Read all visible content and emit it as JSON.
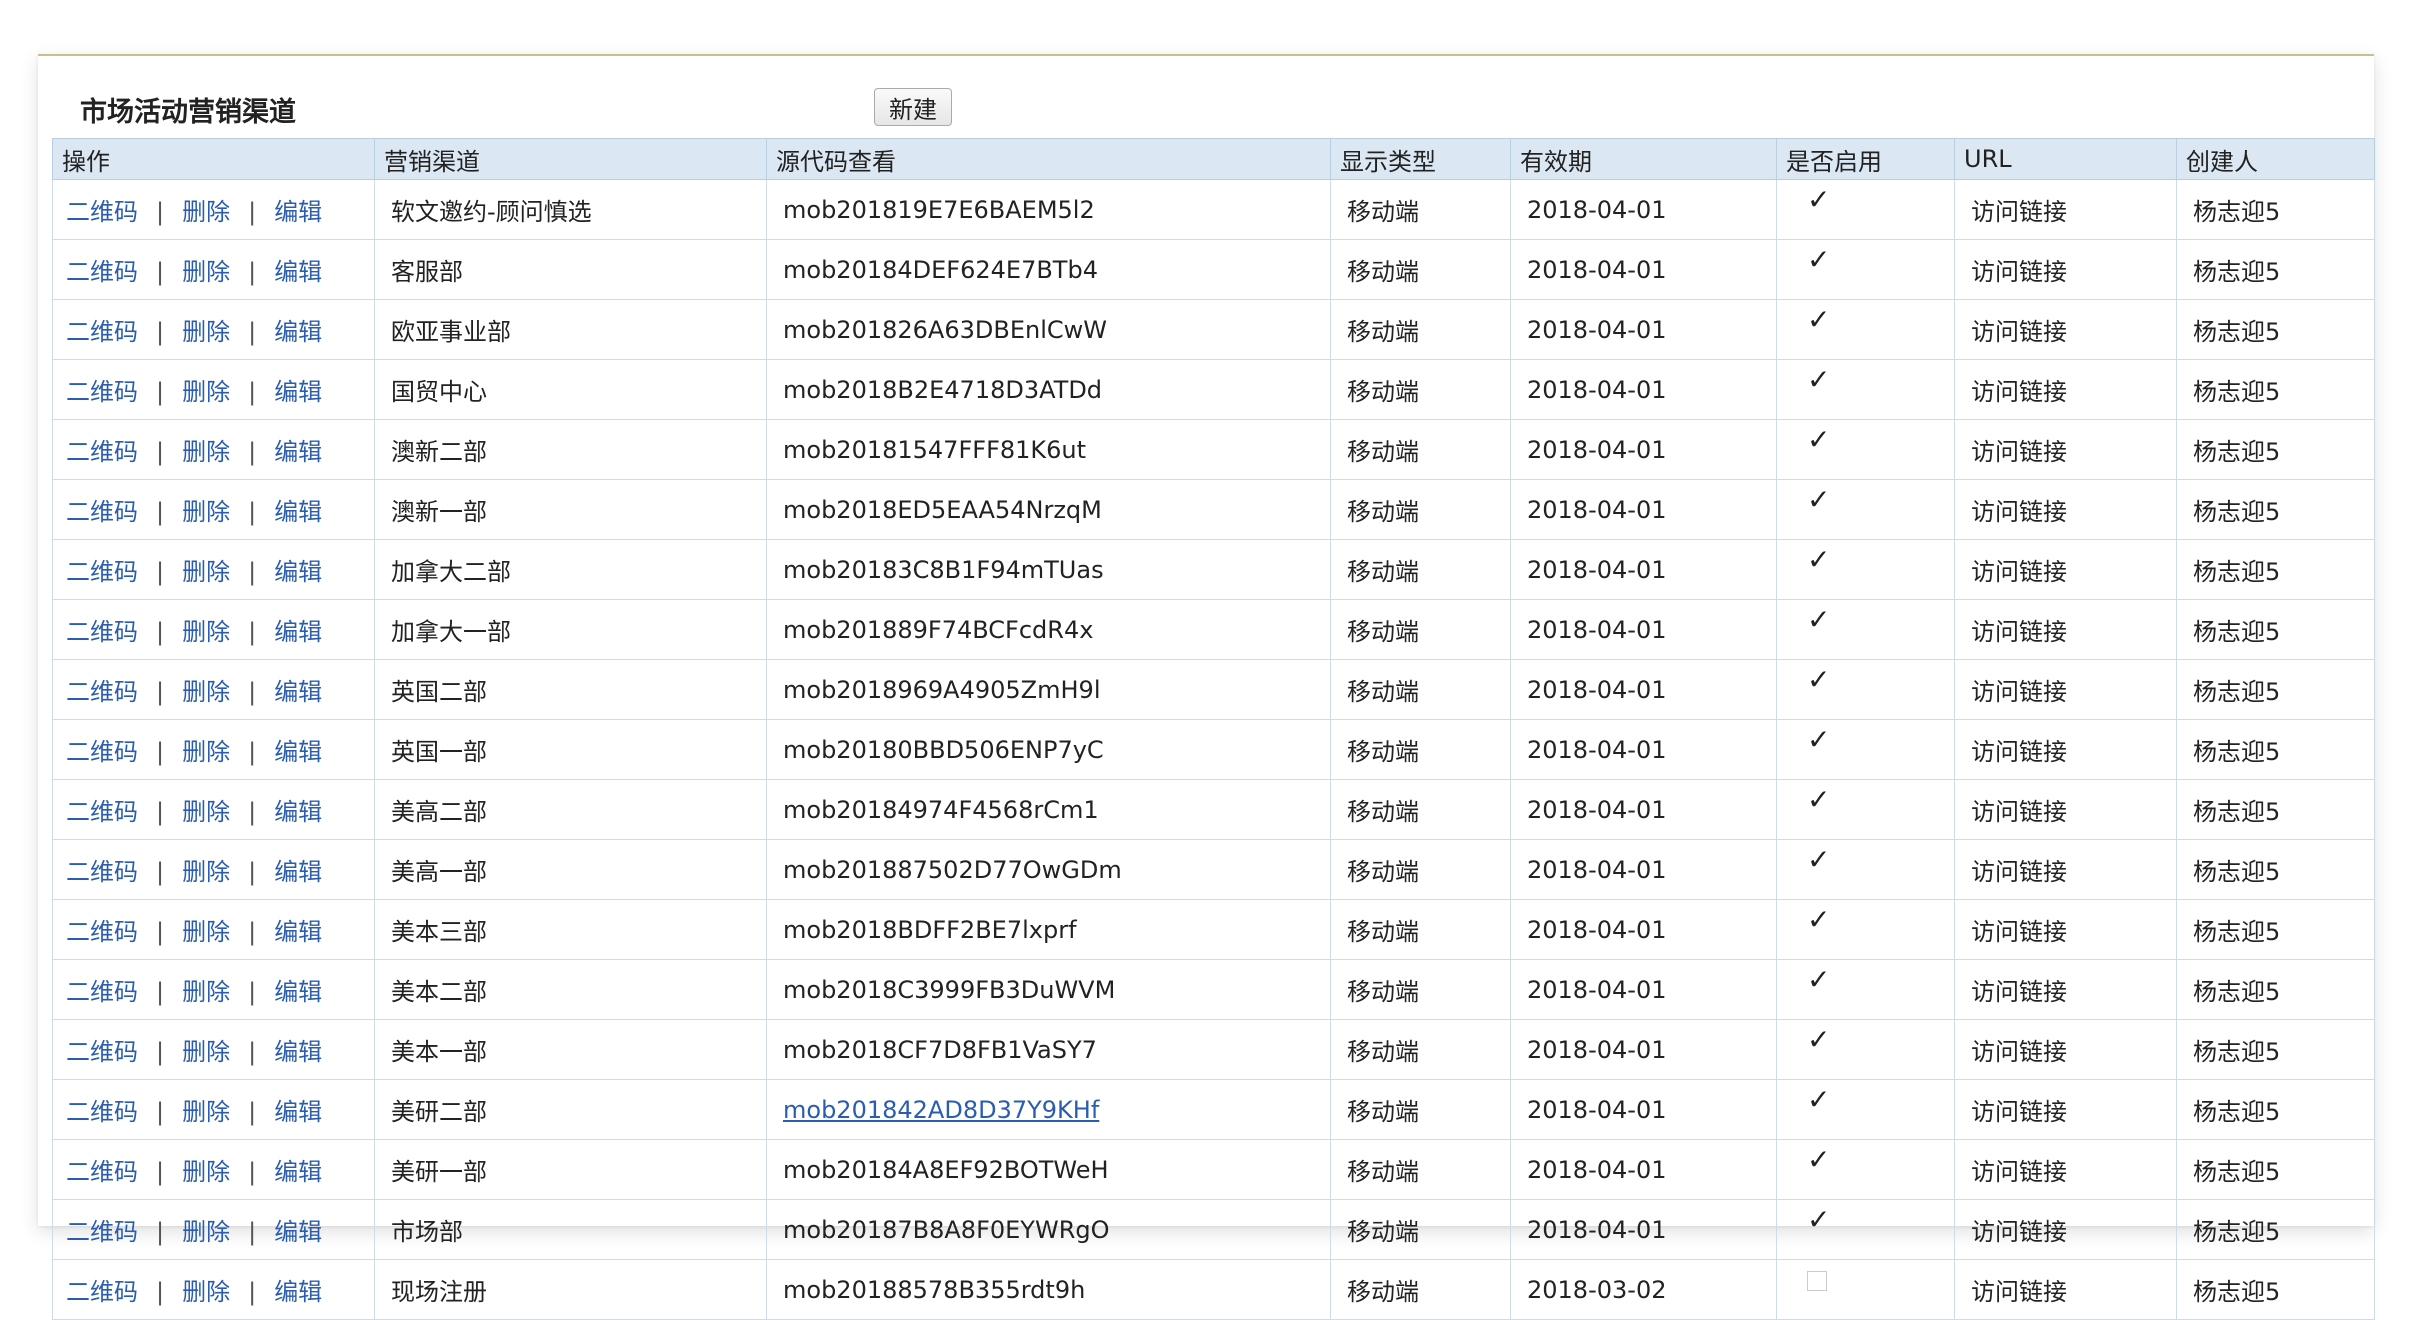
{
  "title": "市场活动营销渠道",
  "new_button": "新建",
  "columns": [
    "操作",
    "营销渠道",
    "源代码查看",
    "显示类型",
    "有效期",
    "是否启用",
    "URL",
    "创建人"
  ],
  "actions": {
    "qrcode": "二维码",
    "delete": "删除",
    "edit": "编辑",
    "separator": "|"
  },
  "check_mark": "✓",
  "rows": [
    {
      "channel": "软文邀约-顾问慎选",
      "source": "mob201819E7E6BAEM5l2",
      "display": "移动端",
      "valid": "2018-04-01",
      "enabled": true,
      "url": "访问链接",
      "creator": "杨志迎5"
    },
    {
      "channel": "客服部",
      "source": "mob20184DEF624E7BTb4",
      "display": "移动端",
      "valid": "2018-04-01",
      "enabled": true,
      "url": "访问链接",
      "creator": "杨志迎5"
    },
    {
      "channel": "欧亚事业部",
      "source": "mob201826A63DBEnlCwW",
      "display": "移动端",
      "valid": "2018-04-01",
      "enabled": true,
      "url": "访问链接",
      "creator": "杨志迎5"
    },
    {
      "channel": "国贸中心",
      "source": "mob2018B2E4718D3ATDd",
      "display": "移动端",
      "valid": "2018-04-01",
      "enabled": true,
      "url": "访问链接",
      "creator": "杨志迎5"
    },
    {
      "channel": "澳新二部",
      "source": "mob20181547FFF81K6ut",
      "display": "移动端",
      "valid": "2018-04-01",
      "enabled": true,
      "url": "访问链接",
      "creator": "杨志迎5"
    },
    {
      "channel": "澳新一部",
      "source": "mob2018ED5EAA54NrzqM",
      "display": "移动端",
      "valid": "2018-04-01",
      "enabled": true,
      "url": "访问链接",
      "creator": "杨志迎5"
    },
    {
      "channel": "加拿大二部",
      "source": "mob20183C8B1F94mTUas",
      "display": "移动端",
      "valid": "2018-04-01",
      "enabled": true,
      "url": "访问链接",
      "creator": "杨志迎5"
    },
    {
      "channel": "加拿大一部",
      "source": "mob201889F74BCFcdR4x",
      "display": "移动端",
      "valid": "2018-04-01",
      "enabled": true,
      "url": "访问链接",
      "creator": "杨志迎5"
    },
    {
      "channel": "英国二部",
      "source": "mob2018969A4905ZmH9l",
      "display": "移动端",
      "valid": "2018-04-01",
      "enabled": true,
      "url": "访问链接",
      "creator": "杨志迎5"
    },
    {
      "channel": "英国一部",
      "source": "mob20180BBD506ENP7yC",
      "display": "移动端",
      "valid": "2018-04-01",
      "enabled": true,
      "url": "访问链接",
      "creator": "杨志迎5"
    },
    {
      "channel": "美高二部",
      "source": "mob20184974F4568rCm1",
      "display": "移动端",
      "valid": "2018-04-01",
      "enabled": true,
      "url": "访问链接",
      "creator": "杨志迎5"
    },
    {
      "channel": "美高一部",
      "source": "mob201887502D77OwGDm",
      "display": "移动端",
      "valid": "2018-04-01",
      "enabled": true,
      "url": "访问链接",
      "creator": "杨志迎5"
    },
    {
      "channel": "美本三部",
      "source": "mob2018BDFF2BE7lxprf",
      "display": "移动端",
      "valid": "2018-04-01",
      "enabled": true,
      "url": "访问链接",
      "creator": "杨志迎5"
    },
    {
      "channel": "美本二部",
      "source": "mob2018C3999FB3DuWVM",
      "display": "移动端",
      "valid": "2018-04-01",
      "enabled": true,
      "url": "访问链接",
      "creator": "杨志迎5"
    },
    {
      "channel": "美本一部",
      "source": "mob2018CF7D8FB1VaSY7",
      "display": "移动端",
      "valid": "2018-04-01",
      "enabled": true,
      "url": "访问链接",
      "creator": "杨志迎5"
    },
    {
      "channel": "美研二部",
      "source": "mob201842AD8D37Y9KHf",
      "source_is_link": true,
      "display": "移动端",
      "valid": "2018-04-01",
      "enabled": true,
      "url": "访问链接",
      "creator": "杨志迎5"
    },
    {
      "channel": "美研一部",
      "source": "mob20184A8EF92BOTWeH",
      "display": "移动端",
      "valid": "2018-04-01",
      "enabled": true,
      "url": "访问链接",
      "creator": "杨志迎5"
    },
    {
      "channel": "市场部",
      "source": "mob20187B8A8F0EYWRgO",
      "display": "移动端",
      "valid": "2018-04-01",
      "enabled": true,
      "url": "访问链接",
      "creator": "杨志迎5"
    },
    {
      "channel": "现场注册",
      "source": "mob20188578B355rdt9h",
      "display": "移动端",
      "valid": "2018-03-02",
      "enabled": false,
      "url": "访问链接",
      "creator": "杨志迎5"
    }
  ]
}
